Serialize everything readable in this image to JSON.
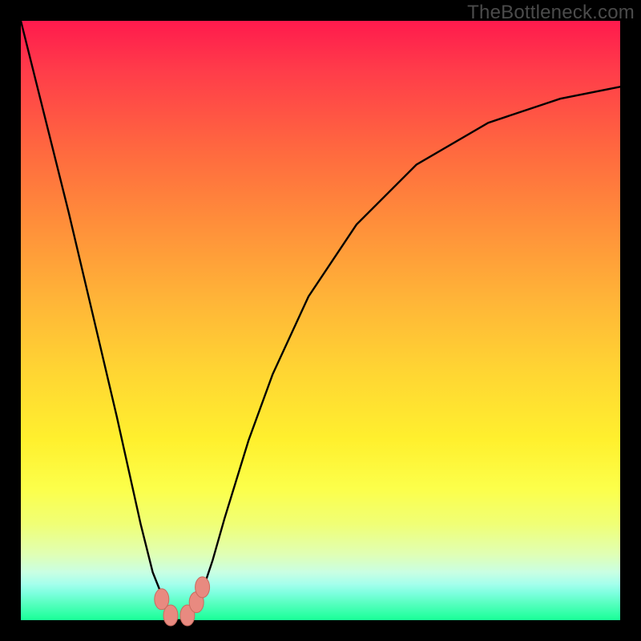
{
  "watermark": "TheBottleneck.com",
  "chart_data": {
    "type": "line",
    "title": "",
    "xlabel": "",
    "ylabel": "",
    "xlim": [
      0,
      100
    ],
    "ylim": [
      0,
      1
    ],
    "series": [
      {
        "name": "curve",
        "x": [
          0,
          4,
          8,
          12,
          16,
          20,
          22,
          24,
          25,
          26,
          27,
          28,
          30,
          32,
          34,
          38,
          42,
          48,
          56,
          66,
          78,
          90,
          100
        ],
        "values": [
          1.0,
          0.84,
          0.68,
          0.51,
          0.34,
          0.16,
          0.08,
          0.03,
          0.01,
          0.0,
          0.0,
          0.01,
          0.04,
          0.1,
          0.17,
          0.3,
          0.41,
          0.54,
          0.66,
          0.76,
          0.83,
          0.87,
          0.89
        ]
      }
    ],
    "grid": false,
    "markers": [
      {
        "name": "pt1",
        "x": 23.5,
        "y": 0.035
      },
      {
        "name": "pt2",
        "x": 25.0,
        "y": 0.008
      },
      {
        "name": "pt3",
        "x": 27.8,
        "y": 0.008
      },
      {
        "name": "pt4",
        "x": 29.3,
        "y": 0.03
      },
      {
        "name": "pt5",
        "x": 30.3,
        "y": 0.055
      }
    ]
  },
  "colors": {
    "curve": "#000000",
    "marker_fill": "#e88a80",
    "marker_stroke": "#c96a5e"
  }
}
